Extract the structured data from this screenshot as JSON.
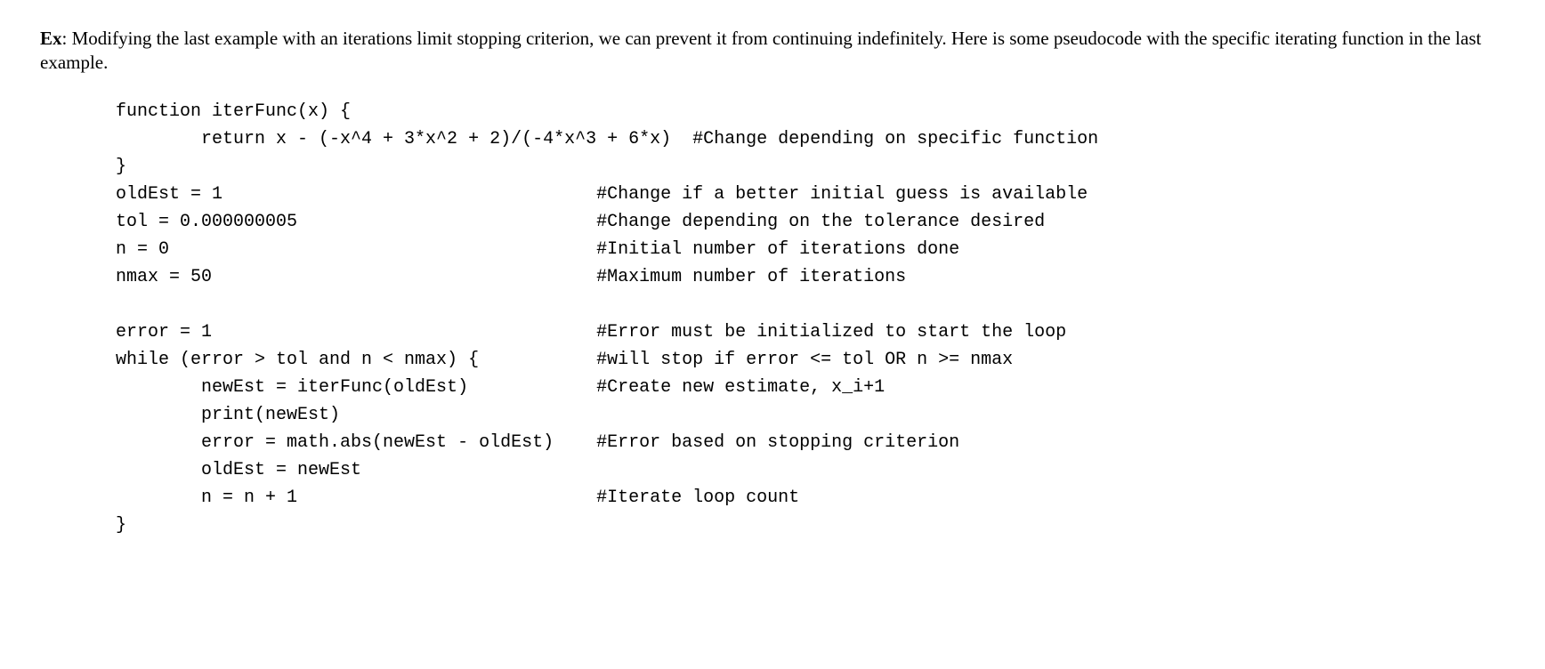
{
  "intro": {
    "label": "Ex",
    "text": ":  Modifying the last example with an iterations limit stopping criterion, we can prevent it from continuing indefinitely.  Here is some pseudocode with the specific iterating function in the last example."
  },
  "code": {
    "line01": "function iterFunc(x) {",
    "line02": "        return x - (-x^4 + 3*x^2 + 2)/(-4*x^3 + 6*x)  #Change depending on specific function",
    "line03": "}",
    "line04": "oldEst = 1                                   #Change if a better initial guess is available",
    "line05": "tol = 0.000000005                            #Change depending on the tolerance desired",
    "line06": "n = 0                                        #Initial number of iterations done",
    "line07": "nmax = 50                                    #Maximum number of iterations",
    "line08": "",
    "line09": "error = 1                                    #Error must be initialized to start the loop",
    "line10": "while (error > tol and n < nmax) {           #will stop if error <= tol OR n >= nmax",
    "line11": "        newEst = iterFunc(oldEst)            #Create new estimate, x_i+1",
    "line12": "        print(newEst)",
    "line13": "        error = math.abs(newEst - oldEst)    #Error based on stopping criterion",
    "line14": "        oldEst = newEst",
    "line15": "        n = n + 1                            #Iterate loop count",
    "line16": "}"
  }
}
